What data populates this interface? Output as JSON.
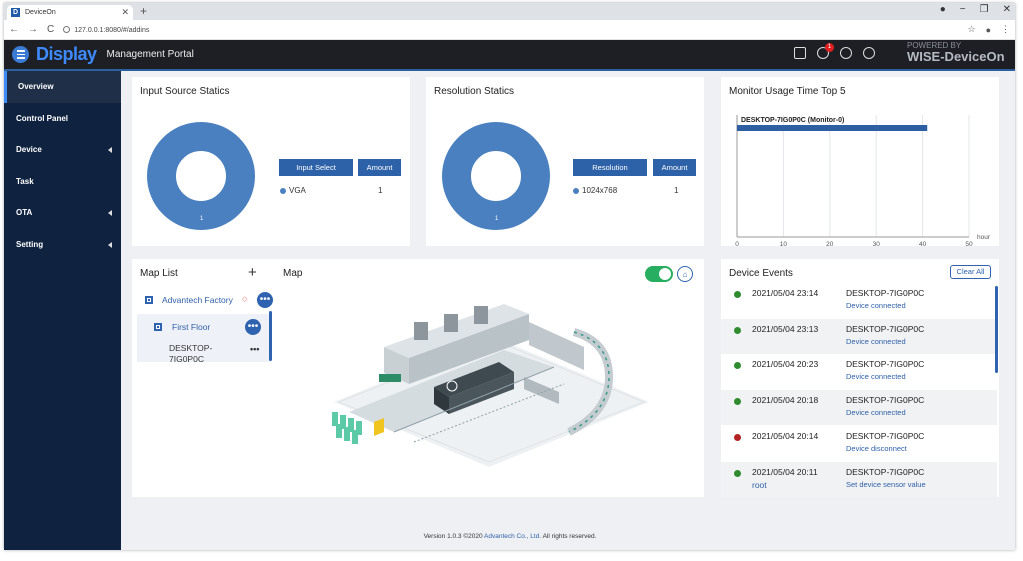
{
  "browser": {
    "tab_title": "DeviceOn",
    "favicon_letter": "D",
    "url": "127.0.0.1:8080/#/addins"
  },
  "header": {
    "brand": "Display",
    "subtitle": "Management Portal",
    "notification_count": "1",
    "powered_line1": "POWERED BY",
    "powered_line2": "WISE-DeviceOn"
  },
  "sidebar": {
    "items": [
      {
        "label": "Overview",
        "active": true,
        "expandable": false
      },
      {
        "label": "Control Panel",
        "active": false,
        "expandable": false
      },
      {
        "label": "Device",
        "active": false,
        "expandable": true
      },
      {
        "label": "Task",
        "active": false,
        "expandable": false
      },
      {
        "label": "OTA",
        "active": false,
        "expandable": true
      },
      {
        "label": "Setting",
        "active": false,
        "expandable": true
      }
    ]
  },
  "input_source": {
    "title": "Input Source Statics",
    "donut_label": "1",
    "col1": "Input Select",
    "col2": "Amount",
    "rows": [
      {
        "name": "VGA",
        "amount": "1"
      }
    ]
  },
  "resolution": {
    "title": "Resolution Statics",
    "donut_label": "1",
    "col1": "Resolution",
    "col2": "Amount",
    "rows": [
      {
        "name": "1024x768",
        "amount": "1"
      }
    ]
  },
  "monitor_usage": {
    "title": "Monitor Usage Time Top 5",
    "axis_unit": "hour",
    "chart_data": {
      "type": "bar",
      "orientation": "horizontal",
      "categories": [
        "DESKTOP-7IG0P0C (Monitor-0)"
      ],
      "values": [
        41
      ],
      "xlim": [
        0,
        50
      ],
      "xticks": [
        "0",
        "10",
        "20",
        "30",
        "40",
        "50"
      ],
      "xlabel": "hour",
      "grid": true,
      "color": "#2f5fa3"
    }
  },
  "map_list": {
    "title": "Map List",
    "add_icon": "plus-icon",
    "items": [
      {
        "label": "Advantech Factory"
      },
      {
        "label": "First Floor"
      }
    ],
    "device_line1": "DESKTOP-",
    "device_line2": "7IG0P0C"
  },
  "map": {
    "title": "Map",
    "toggle_on": true
  },
  "device_events": {
    "title": "Device Events",
    "clear_label": "Clear All",
    "events": [
      {
        "time": "2021/05/04 23:14",
        "device": "DESKTOP-7IG0P0C",
        "message": "Device connected",
        "status_color": "#2e8b2e",
        "user": ""
      },
      {
        "time": "2021/05/04 23:13",
        "device": "DESKTOP-7IG0P0C",
        "message": "Device connected",
        "status_color": "#2e8b2e",
        "user": ""
      },
      {
        "time": "2021/05/04 20:23",
        "device": "DESKTOP-7IG0P0C",
        "message": "Device connected",
        "status_color": "#2e8b2e",
        "user": ""
      },
      {
        "time": "2021/05/04 20:18",
        "device": "DESKTOP-7IG0P0C",
        "message": "Device connected",
        "status_color": "#2e8b2e",
        "user": ""
      },
      {
        "time": "2021/05/04 20:14",
        "device": "DESKTOP-7IG0P0C",
        "message": "Device disconnect",
        "status_color": "#b22222",
        "user": ""
      },
      {
        "time": "2021/05/04 20:11",
        "device": "DESKTOP-7IG0P0C",
        "message": "Set device sensor value",
        "status_color": "#2e8b2e",
        "user": "root"
      }
    ]
  },
  "footer": {
    "before": "Version 1.0.3 ©2020 ",
    "link": "Advantech Co., Ltd.",
    "after": " All rights reserved."
  }
}
